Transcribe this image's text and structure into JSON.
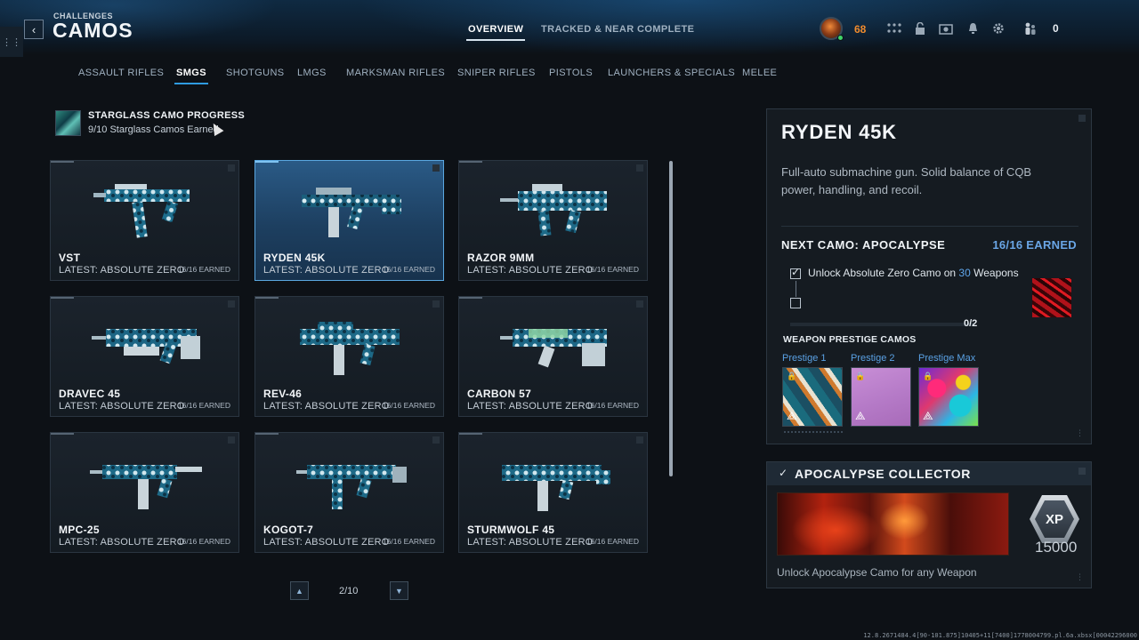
{
  "header": {
    "breadcrumb": "CHALLENGES",
    "title": "CAMOS",
    "tabs": [
      {
        "label": "OVERVIEW",
        "active": true
      },
      {
        "label": "TRACKED & NEAR COMPLETE",
        "active": false
      }
    ],
    "level": "68",
    "currency": "0",
    "icons": [
      "menu-grid-icon",
      "unlock-icon",
      "camera-icon",
      "bell-icon",
      "gear-icon",
      "friends-icon"
    ]
  },
  "categories": [
    {
      "label": "ASSAULT RIFLES",
      "active": false
    },
    {
      "label": "SMGS",
      "active": true
    },
    {
      "label": "SHOTGUNS",
      "active": false
    },
    {
      "label": "LMGS",
      "active": false
    },
    {
      "label": "MARKSMAN RIFLES",
      "active": false
    },
    {
      "label": "SNIPER RIFLES",
      "active": false
    },
    {
      "label": "PISTOLS",
      "active": false
    },
    {
      "label": "LAUNCHERS & SPECIALS",
      "active": false
    },
    {
      "label": "MELEE",
      "active": false
    }
  ],
  "progress": {
    "title": "STARGLASS CAMO PROGRESS",
    "subtitle": "9/10 Starglass Camos Earned"
  },
  "weapons": [
    {
      "name": "VST",
      "latest": "LATEST: ABSOLUTE ZERO",
      "count": "16/16 EARNED",
      "selected": false
    },
    {
      "name": "RYDEN 45K",
      "latest": "LATEST: ABSOLUTE ZERO",
      "count": "16/16 EARNED",
      "selected": true
    },
    {
      "name": "RAZOR 9MM",
      "latest": "LATEST: ABSOLUTE ZERO",
      "count": "16/16 EARNED",
      "selected": false
    },
    {
      "name": "DRAVEC 45",
      "latest": "LATEST: ABSOLUTE ZERO",
      "count": "16/16 EARNED",
      "selected": false
    },
    {
      "name": "REV-46",
      "latest": "LATEST: ABSOLUTE ZERO",
      "count": "16/16 EARNED",
      "selected": false
    },
    {
      "name": "CARBON 57",
      "latest": "LATEST: ABSOLUTE ZERO",
      "count": "16/16 EARNED",
      "selected": false
    },
    {
      "name": "MPC-25",
      "latest": "LATEST: ABSOLUTE ZERO",
      "count": "16/16 EARNED",
      "selected": false
    },
    {
      "name": "KOGOT-7",
      "latest": "LATEST: ABSOLUTE ZERO",
      "count": "16/16 EARNED",
      "selected": false
    },
    {
      "name": "STURMWOLF 45",
      "latest": "LATEST: ABSOLUTE ZERO",
      "count": "16/16 EARNED",
      "selected": false
    }
  ],
  "pager": {
    "text": "2/10"
  },
  "detail": {
    "weapon_name": "RYDEN 45K",
    "description": "Full-auto submachine gun. Solid balance of CQB power, handling, and recoil.",
    "next_camo": "NEXT CAMO: APOCALYPSE",
    "earned": "16/16 EARNED",
    "task_prefix": "Unlock Absolute Zero Camo on ",
    "task_number": "30",
    "task_suffix": " Weapons",
    "task_progress": "0/2",
    "prestige_heading": "WEAPON PRESTIGE CAMOS",
    "prestige": [
      {
        "label": "Prestige 1"
      },
      {
        "label": "Prestige 2"
      },
      {
        "label": "Prestige Max"
      }
    ]
  },
  "collector": {
    "title": "APOCALYPSE COLLECTOR",
    "xp_label": "XP",
    "xp_amount": "15000",
    "description": "Unlock Apocalypse Camo for any Weapon"
  },
  "build_string": "12.8.2671484.4[90-101.875]10405+11[7400]1778004799.pl.6a.xbsx[00042296000",
  "colors": {
    "accent_blue": "#2f9be0",
    "selected_card": "#2a5a86",
    "level_orange": "#f08b2d",
    "earned_blue": "#6aa6e6"
  }
}
